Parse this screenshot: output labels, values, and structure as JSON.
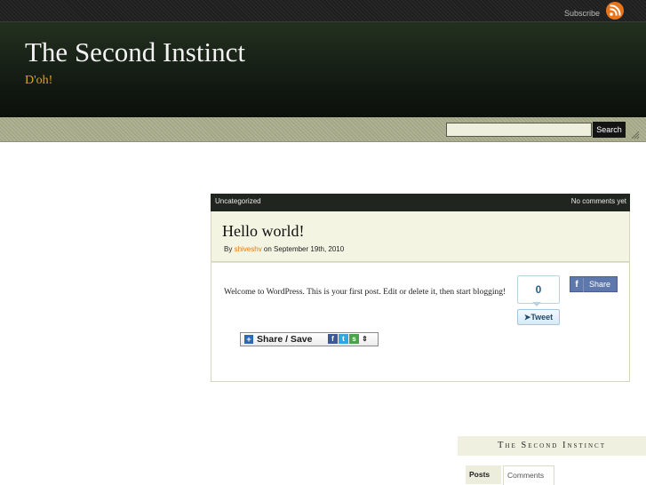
{
  "topbar": {
    "subscribe_label": "Subscribe"
  },
  "header": {
    "site_title": "The Second Instinct",
    "tagline": "D'oh!"
  },
  "search": {
    "placeholder": "",
    "button_label": "Search"
  },
  "post": {
    "category": "Uncategorized",
    "comments": "No comments yet",
    "title": "Hello world!",
    "by_prefix": "By ",
    "author": "shiveshv",
    "date_text": " on September 19th, 2010",
    "body": "Welcome to WordPress. This is your first post. Edit or delete it, then start blogging!"
  },
  "social": {
    "tweet_count": "0",
    "tweet_label": "Tweet",
    "facebook_label": "Share",
    "share_save_label": "Share / Save"
  },
  "sidebar": {
    "widget_title": "The Second Instinct",
    "tabs": [
      "Posts",
      "Comments"
    ]
  },
  "colors": {
    "header_bg": "#111811",
    "tagline": "#d8a32a",
    "author_link": "#e07b16",
    "meta_bar": "#20261f",
    "post_head_bg": "#f3f4e2"
  }
}
